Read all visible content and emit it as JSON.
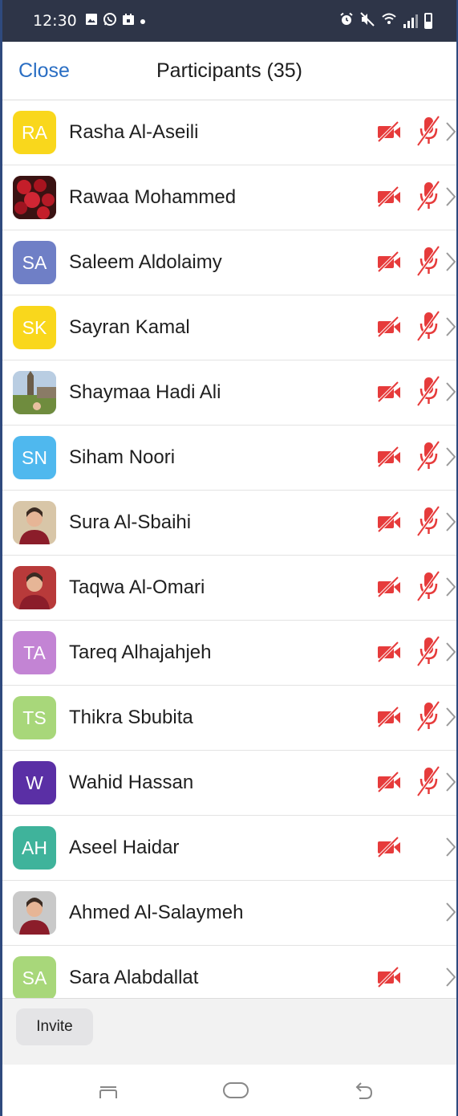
{
  "status_bar": {
    "time": "12:30",
    "icons_left": [
      "image-icon",
      "whatsapp-icon",
      "calendar-icon",
      "dot-icon"
    ],
    "icons_right": [
      "alarm-icon",
      "mute-icon",
      "wifi-icon",
      "signal-icon",
      "battery-icon"
    ]
  },
  "header": {
    "close_label": "Close",
    "title": "Participants (35)"
  },
  "colors": {
    "accent_blue": "#2a6ec3",
    "muted_red": "#e63b3b",
    "status_bar_bg": "#2e3548"
  },
  "participants": [
    {
      "initials": "RA",
      "name": "Rasha Al-Aseili",
      "avatar_color": "#f9d71c",
      "photo": false,
      "video_off": true,
      "mic_muted": true
    },
    {
      "initials": "",
      "name": "Rawaa Mohammed",
      "avatar_color": "#6b1d1d",
      "photo": true,
      "photo_subject": "roses",
      "video_off": true,
      "mic_muted": true
    },
    {
      "initials": "SA",
      "name": "Saleem Aldolaimy",
      "avatar_color": "#6f7fc6",
      "photo": false,
      "video_off": true,
      "mic_muted": true
    },
    {
      "initials": "SK",
      "name": "Sayran Kamal",
      "avatar_color": "#f9d71c",
      "photo": false,
      "video_off": true,
      "mic_muted": true
    },
    {
      "initials": "",
      "name": "Shaymaa Hadi Ali",
      "avatar_color": "#8fb3d9",
      "photo": true,
      "photo_subject": "landmark",
      "video_off": true,
      "mic_muted": true
    },
    {
      "initials": "SN",
      "name": "Siham Noori",
      "avatar_color": "#4fb8ee",
      "photo": false,
      "video_off": true,
      "mic_muted": true
    },
    {
      "initials": "",
      "name": "Sura Al-Sbaihi",
      "avatar_color": "#d8c6a8",
      "photo": true,
      "photo_subject": "person",
      "video_off": true,
      "mic_muted": true
    },
    {
      "initials": "",
      "name": "Taqwa Al-Omari",
      "avatar_color": "#b83a3a",
      "photo": true,
      "photo_subject": "person",
      "video_off": true,
      "mic_muted": true
    },
    {
      "initials": "TA",
      "name": "Tareq Alhajahjeh",
      "avatar_color": "#c384d4",
      "photo": false,
      "video_off": true,
      "mic_muted": true
    },
    {
      "initials": "TS",
      "name": "Thikra Sbubita",
      "avatar_color": "#a8d77a",
      "photo": false,
      "video_off": true,
      "mic_muted": true
    },
    {
      "initials": "W",
      "name": "Wahid Hassan",
      "avatar_color": "#5a2fa5",
      "photo": false,
      "video_off": true,
      "mic_muted": true
    },
    {
      "initials": "AH",
      "name": "Aseel Haidar",
      "avatar_color": "#3fb39b",
      "photo": false,
      "video_off": true,
      "mic_muted": false
    },
    {
      "initials": "",
      "name": "Ahmed Al-Salaymeh",
      "avatar_color": "#c9c9c9",
      "photo": true,
      "photo_subject": "person",
      "video_off": false,
      "mic_muted": false
    },
    {
      "initials": "SA",
      "name": "Sara Alabdallat",
      "avatar_color": "#a8d77a",
      "photo": false,
      "video_off": true,
      "mic_muted": false
    }
  ],
  "footer": {
    "invite_label": "Invite"
  },
  "nav_bar": {
    "icons": [
      "recents-icon",
      "home-icon",
      "back-icon"
    ]
  }
}
